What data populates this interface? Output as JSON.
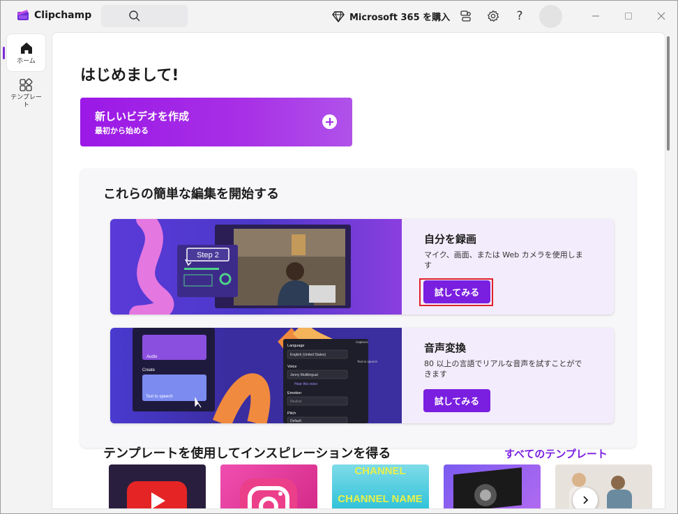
{
  "app": {
    "title": "Clipchamp"
  },
  "header": {
    "m365_label": "Microsoft 365 を購入"
  },
  "sidebar": {
    "items": [
      {
        "label": "ホーム"
      },
      {
        "label": "テンプレート"
      }
    ]
  },
  "main": {
    "greeting": "はじめまして!",
    "new_video": {
      "title": "新しいビデオを作成",
      "subtitle": "最初から始める"
    },
    "edits": {
      "title": "これらの簡単な編集を開始する",
      "cards": [
        {
          "title": "自分を録画",
          "description": "マイク、画面、または Web カメラを使用します",
          "button": "試してみる",
          "thumb_label": "Step 2"
        },
        {
          "title": "音声変換",
          "description": "80 以上の言語でリアルな音声を試すことができます",
          "button": "試してみる",
          "thumb_texts": {
            "audio": "Audio",
            "create": "Create",
            "tts": "Text to speech",
            "language": "Language",
            "language_value": "English (United States)",
            "voice": "Voice",
            "voice_value": "Jenny Multilingual",
            "hear": "Hear this voice",
            "emotion": "Emotion",
            "emotion_value": "Neutral",
            "pitch": "Pitch",
            "pitch_value": "Default",
            "captions": "Captions",
            "tts_side": "Text to speech"
          }
        }
      ]
    },
    "templates": {
      "title": "テンプレートを使用してインスピレーションを得る",
      "view_all": "すべてのテンプレート",
      "thumbs": [
        {
          "name": "youtube"
        },
        {
          "name": "instagram"
        },
        {
          "name": "channel-name",
          "text1": "CHANNEL",
          "text2": "CHANNEL NAME"
        },
        {
          "name": "space-screen"
        },
        {
          "name": "people"
        }
      ]
    }
  },
  "colors": {
    "accent": "#7a1fe0",
    "gradient_start": "#9b18e6",
    "highlight_border": "#e0202a"
  }
}
